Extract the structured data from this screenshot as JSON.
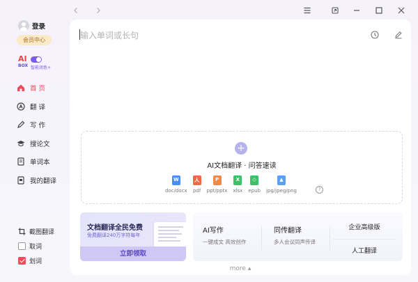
{
  "window": {
    "controls": [
      "menu-icon",
      "pin-icon",
      "minimize-icon",
      "maximize-icon",
      "close-icon"
    ]
  },
  "sidebar": {
    "login_label": "登录",
    "vip_label": "会员中心",
    "ai_box": {
      "logo": "AI",
      "box_label": "BOX",
      "sub_label": "智能润色+"
    },
    "nav": [
      {
        "label": "首 页",
        "icon": "home-icon",
        "active": true
      },
      {
        "label": "翻 译",
        "icon": "translate-icon",
        "active": false
      },
      {
        "label": "写 作",
        "icon": "pen-icon",
        "active": false
      },
      {
        "label": "搜论文",
        "icon": "graduation-cap-icon",
        "active": false
      },
      {
        "label": "单词本",
        "icon": "book-icon",
        "active": false
      },
      {
        "label": "我的翻译",
        "icon": "document-icon",
        "active": false
      }
    ],
    "tools": [
      {
        "label": "截图翻译",
        "icon": "crop-icon"
      },
      {
        "label": "取词",
        "checked": false
      },
      {
        "label": "划词",
        "checked": true
      }
    ]
  },
  "main": {
    "input_placeholder": "输入单词或长句",
    "dropzone": {
      "plus": "+",
      "title": "AI文档翻译 · 问答速读",
      "types": [
        {
          "label": "doc/docx",
          "letter": "W",
          "color": "#4a8ff0"
        },
        {
          "label": "pdf",
          "letter": "人",
          "color": "#ef6a4a"
        },
        {
          "label": "ppt/pptx",
          "letter": "P",
          "color": "#f08a4a"
        },
        {
          "label": "xlsx",
          "letter": "X",
          "color": "#3fbf6a"
        },
        {
          "label": "epub",
          "letter": "◇",
          "color": "#3fbf6a"
        },
        {
          "label": "jpg/jpeg/png",
          "letter": "▲",
          "color": "#5aa0f0"
        }
      ],
      "help": "?"
    },
    "promo": {
      "title": "文档翻译全民免费",
      "subtitle": "免费翻译240万字符每年",
      "button": "立即领取"
    },
    "features": {
      "ai_writing": {
        "title": "AI写作",
        "subtitle": "一键成文 高效创作"
      },
      "simultaneous": {
        "title": "同传翻译",
        "subtitle": "多人会议同声传译"
      },
      "enterprise": "企业高级版",
      "human": "人工翻译"
    },
    "more_label": "more ▴"
  }
}
